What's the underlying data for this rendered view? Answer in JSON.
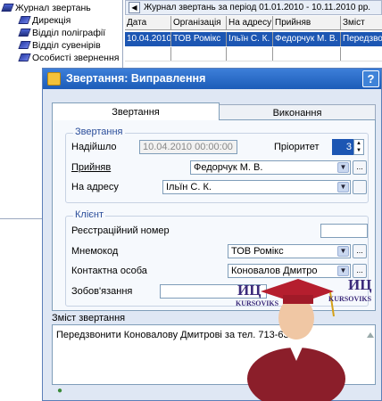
{
  "tree": {
    "items": [
      {
        "label": "Журнал звертань",
        "indent": 0,
        "icon": "tree-folder-icon"
      },
      {
        "label": "Дирекція",
        "indent": 1,
        "icon": "diamond-icon"
      },
      {
        "label": "Відділ поліграфії",
        "indent": 1,
        "icon": "book-icon"
      },
      {
        "label": "Відділ сувенірів",
        "indent": 1,
        "icon": "diamond-icon"
      },
      {
        "label": "Особисті звернення",
        "indent": 1,
        "icon": "diamond-icon"
      }
    ]
  },
  "grid": {
    "title": "Журнал звертань за період 01.01.2010 - 10.11.2010 рр.",
    "back_glyph": "◀",
    "columns": [
      "Дата",
      "Організація",
      "На адресу",
      "Прийняв",
      "Зміст"
    ],
    "rows": [
      [
        "10.04.2010",
        "ТОВ Ромікс",
        "Ільїн С. К.",
        "Федорчук М. В.",
        "Передзвон"
      ]
    ]
  },
  "dialog": {
    "title": "Звертання: Виправлення",
    "help_glyph": "?",
    "tabs": [
      "Звертання",
      "Виконання"
    ],
    "group_request": "Звертання",
    "received_label": "Надійшло",
    "received_value": "10.04.2010 00:00:00",
    "priority_label": "Пріоритет",
    "priority_value": "3",
    "accepted_label": "Прийняв",
    "accepted_value": "Федорчук М. В.",
    "addressee_label": "На адресу",
    "addressee_value": "Ільїн С. К.",
    "group_client": "Клієнт",
    "reg_number_label": "Реєстраційний номер",
    "reg_number_value": "",
    "mnemo_label": "Мнемокод",
    "mnemo_value": "ТОВ Ромікс",
    "contact_label": "Контактна особа",
    "contact_value": "Коновалов Дмитро",
    "obligation_label": "Зобов'язання",
    "obligation_value": "",
    "content_label": "Зміст звертання",
    "content_value": "Передзвонити Коновалову Дмитрові за тел. 713-63-01",
    "ellipsis": "...",
    "dropdown_glyph": "▼"
  },
  "watermark": {
    "left_text": "ИЦ",
    "left_sub": "KURSOVIKS",
    "right_text": "ИЦ",
    "right_sub": "KURSOVIKS"
  }
}
